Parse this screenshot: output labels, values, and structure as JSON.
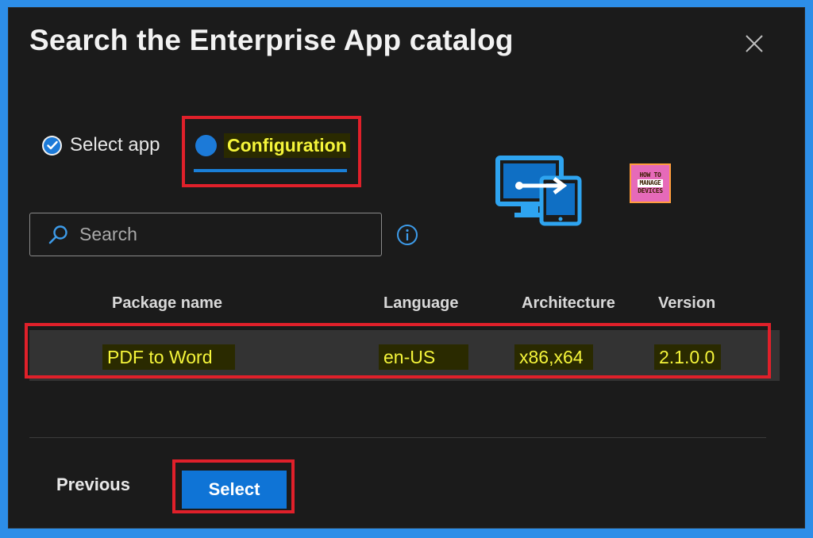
{
  "dialog": {
    "title": "Search the Enterprise App catalog"
  },
  "tabs": [
    {
      "label": "Select app",
      "state": "completed"
    },
    {
      "label": "Configuration",
      "state": "active"
    }
  ],
  "search": {
    "placeholder": "Search",
    "value": ""
  },
  "table": {
    "columns": [
      "Package name",
      "Language",
      "Architecture",
      "Version"
    ],
    "rows": [
      {
        "package_name": "PDF to Word",
        "language": "en-US",
        "architecture": "x86,x64",
        "version": "2.1.0.0"
      }
    ]
  },
  "footer": {
    "previous_label": "Previous",
    "select_label": "Select"
  },
  "logo": {
    "line1": "HOW TO",
    "line2": "MANAGE",
    "line3": "DEVICES"
  },
  "colors": {
    "accent": "#0f74d6",
    "highlight_box": "#e0202a",
    "highlight_text": "#f5f53a",
    "dialog_bg": "#1b1b1b",
    "page_border": "#2d8ee8"
  }
}
